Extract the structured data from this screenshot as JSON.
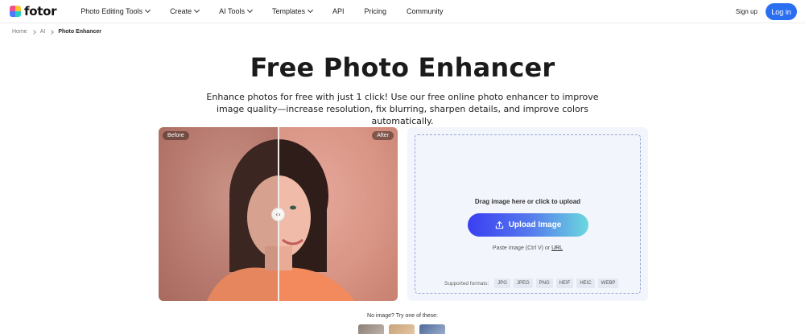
{
  "brand": {
    "logo_text": "fotor",
    "logo_colors": [
      "#f44f8b",
      "#ffc531",
      "#4d7cff",
      "#25d1c4"
    ]
  },
  "nav": {
    "items": [
      {
        "label": "Photo Editing Tools",
        "has_dropdown": true
      },
      {
        "label": "Create",
        "has_dropdown": true
      },
      {
        "label": "AI Tools",
        "has_dropdown": true
      },
      {
        "label": "Templates",
        "has_dropdown": true
      },
      {
        "label": "API",
        "has_dropdown": false
      },
      {
        "label": "Pricing",
        "has_dropdown": false
      },
      {
        "label": "Community",
        "has_dropdown": false
      }
    ],
    "signup_label": "Sign up",
    "login_label": "Log in"
  },
  "breadcrumb": {
    "home": "Home",
    "ai": "AI",
    "current": "Photo Enhancer"
  },
  "hero": {
    "title": "Free Photo Enhancer",
    "subtitle": "Enhance photos for free with just 1 click! Use our free online photo enhancer to improve image quality—increase resolution, fix blurring, sharpen details, and improve colors automatically."
  },
  "compare": {
    "before_label": "Before",
    "after_label": "After",
    "handle_glyph": "‹›"
  },
  "upload": {
    "drag_text": "Drag image here or click to upload",
    "button_label": "Upload Image",
    "paste_text": "Paste image (Ctrl V) or",
    "url_label": "URL",
    "formats_label": "Supported formats:",
    "formats": [
      "JPG",
      "JPEG",
      "PNG",
      "HEIF",
      "HEIC",
      "WEBP"
    ]
  },
  "samples": {
    "label": "No image? Try one of these:"
  },
  "colors": {
    "accent": "#2a6ff2",
    "upload_gradient": [
      "#3a3ff0",
      "#6bd8de"
    ]
  }
}
